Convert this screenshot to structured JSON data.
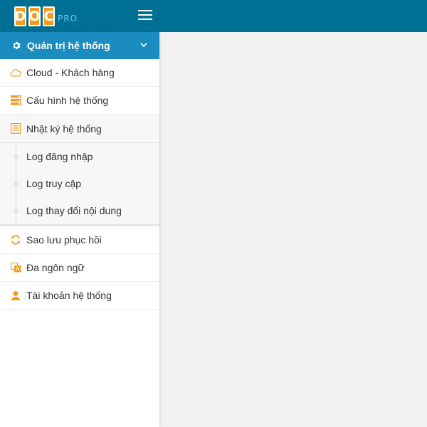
{
  "brand": {
    "letters": [
      "D",
      "O",
      "C"
    ],
    "suffix": "PRO"
  },
  "sidebar": {
    "group_label": "Quản trị hệ thống",
    "items": [
      {
        "label": "Cloud - Khách hàng",
        "icon": "cloud-icon"
      },
      {
        "label": "Cấu hình hệ thống",
        "icon": "server-icon"
      },
      {
        "label": "Nhật ký hệ thống",
        "icon": "log-book-icon"
      }
    ],
    "submenu": [
      {
        "label": "Log đăng nhập"
      },
      {
        "label": "Log truy cập"
      },
      {
        "label": "Log thay đổi nội dung"
      }
    ],
    "items_after": [
      {
        "label": "Sao lưu phục hồi",
        "icon": "sync-icon"
      },
      {
        "label": "Đa ngôn ngữ",
        "icon": "language-icon"
      },
      {
        "label": "Tài khoản hệ thống",
        "icon": "user-icon"
      }
    ]
  },
  "colors": {
    "topbar": "#006f94",
    "group_header": "#1b8cbf",
    "accent": "#f39c1f"
  }
}
